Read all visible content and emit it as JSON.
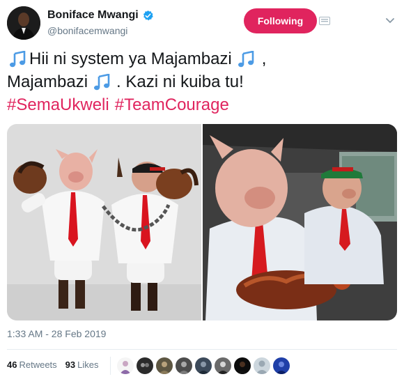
{
  "author": {
    "display_name": "Boniface Mwangi",
    "handle": "@bonifacemwangi",
    "verified": true
  },
  "follow_button": {
    "label": "Following",
    "color": "#e0245e"
  },
  "tweet": {
    "line1_a": "Hii ni system ya Majambazi",
    "line1_b": ",",
    "line2_a": "Majambazi",
    "line2_b": ". Kazi ni kuiba tu!",
    "hashtags": [
      "#SemaUkweli",
      "#TeamCourage"
    ]
  },
  "timestamp": "1:33 AM - 28 Feb 2019",
  "stats": {
    "retweets_count": "46",
    "retweets_label": "Retweets",
    "likes_count": "93",
    "likes_label": "Likes"
  },
  "colors": {
    "accent": "#e0245e",
    "link_blue": "#1da1f2",
    "secondary_text": "#657786"
  },
  "icons": [
    "verified-badge-icon",
    "music-note-icon",
    "direct-message-icon",
    "chevron-down-icon"
  ]
}
